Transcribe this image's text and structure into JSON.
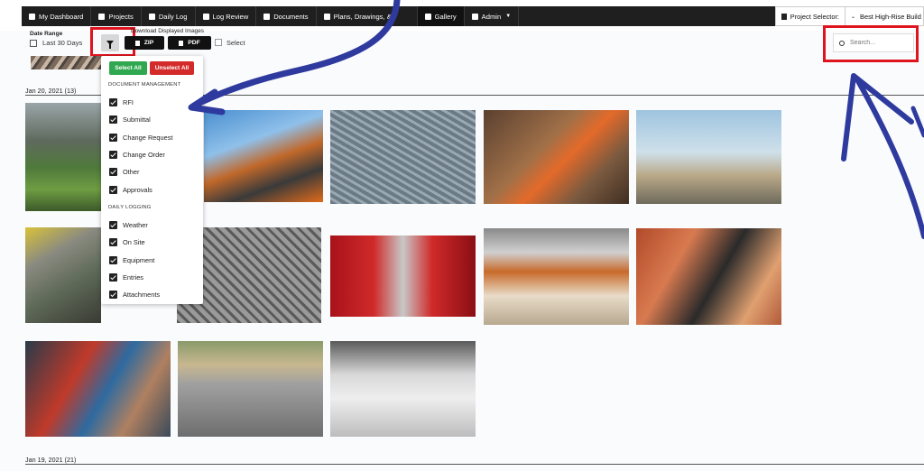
{
  "nav": {
    "items": [
      {
        "label": "My Dashboard"
      },
      {
        "label": "Projects"
      },
      {
        "label": "Daily Log"
      },
      {
        "label": "Log Review"
      },
      {
        "label": "Documents"
      },
      {
        "label": "Plans, Drawings, &"
      },
      {
        "label": "Gallery"
      },
      {
        "label": "Admin"
      }
    ],
    "project_selector_label": "Project Selector:",
    "project_selector_value": "Best High-Rise Build"
  },
  "filters": {
    "date_range_label": "Date Range",
    "date_range_value": "Last 30 Days",
    "download_label": "Download Displayed Images",
    "zip_label": "ZIP",
    "pdf_label": "PDF",
    "select_label": "Select",
    "search_placeholder": "Search..."
  },
  "dropdown": {
    "select_all": "Select All",
    "unselect_all": "Unselect All",
    "groups": [
      {
        "heading": "DOCUMENT MANAGEMENT",
        "items": [
          "RFI",
          "Submittal",
          "Change Request",
          "Change Order",
          "Other",
          "Approvals"
        ]
      },
      {
        "heading": "DAILY LOGGING",
        "items": [
          "Weather",
          "On Site",
          "Equipment",
          "Entries",
          "Attachments"
        ]
      }
    ]
  },
  "sections": [
    {
      "title": "Jan 20, 2021 (13)"
    },
    {
      "title": "Jan 19, 2021 (21)"
    }
  ],
  "colors": {
    "nav_bg": "#1f1f1f",
    "select_all": "#2fa84f",
    "unselect_all": "#d32a2a",
    "highlight_box": "#e0141e",
    "annotation_arrow": "#2e3a9e"
  },
  "photos": [
    "rainy-construction-site",
    "ironworkers-on-scaffold",
    "workers-placing-rebar",
    "worker-in-rebar-trench",
    "concrete-pump-worker",
    "worker-cutting-rebar",
    "rebar-grid-worker",
    "burst-water-pipe",
    "hallway-interior-framing",
    "electrical-wiring-wall",
    "plumber-fixing-valve",
    "fresh-concrete-pour",
    "empty-interior-floor"
  ]
}
